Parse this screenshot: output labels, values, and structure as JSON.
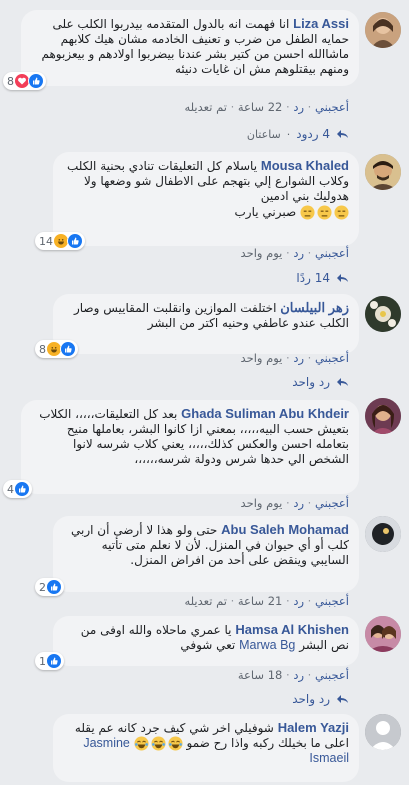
{
  "comments": [
    {
      "author": "Liza Assi",
      "text": "انا فهمت انه بالدول المتقدمه بيدربوا الكلب على حمايه الطفل من ضرب و تعنيف الخادمه مشان هيك كلابهم ماشاالله احسن من كتير بشر عندنا بيضربوا اولادهم و بيعزبوهم ومنهم بيقتلوهم مش ان غايات دنيئه",
      "reaction_count": "8",
      "reactions": [
        "like-icon",
        "love-icon"
      ],
      "like": "أعجبني",
      "reply": "رد",
      "time": "22 ساعة",
      "edited": "تم تعديله",
      "replies_label": "4 ردود",
      "replies_time": "ساعتان"
    },
    {
      "author": "Mousa Khaled",
      "text": "ياسلام كل التعليقات تنادي بحنية الكلب وكلاب الشوارع إلي بتهجم على الاطفال شو وضعها ولا هدوليك بني ادمين",
      "text2": "صبرني يارب",
      "reaction_count": "14",
      "reactions": [
        "like-icon",
        "haha-icon"
      ],
      "like": "أعجبني",
      "reply": "رد",
      "time": "يوم واحد",
      "replies_label": "14 ردًا"
    },
    {
      "author": "زهر البيلسان",
      "text": "اختلفت الموازين وانقلبت المقاييس وصار الكلب عندو عاطفي وحنيه اكتر من البشر",
      "reaction_count": "8",
      "reactions": [
        "like-icon",
        "haha-icon"
      ],
      "like": "أعجبني",
      "reply": "رد",
      "time": "يوم واحد",
      "replies_label": "رد واحد"
    },
    {
      "author": "Ghada Suliman Abu Khdeir",
      "text": "بعد كل التعليقات،،،،، الكلاب بتعيش حسب البيه،،،،، بمعني ازا كانوا البشر، بعاملها منيح بتعامله احسن والعكس كذلك،،،،، يعني كلاب شرسه لانوا الشخص الي حدها شرس ودولة شرسه،،،،،،",
      "reaction_count": "4",
      "reactions": [
        "like-icon"
      ],
      "like": "أعجبني",
      "reply": "رد",
      "time": "يوم واحد"
    },
    {
      "author": "Abu Saleh Mohamad",
      "text": "حتى ولو هذا لا أرضى أن اربي كلب أو أي حيوان في المنزل. لأن لا نعلم متى تأتيه السايبي وينقض على أحد من افراض المنزل.",
      "reaction_count": "2",
      "reactions": [
        "like-icon"
      ],
      "like": "أعجبني",
      "reply": "رد",
      "time": "21 ساعة",
      "edited": "تم تعديله"
    },
    {
      "author": "Hamsa Al Khishen",
      "text": "يا عمري ماحلاه والله اوفى من نص البشر",
      "mention": "Marwa Bg",
      "text2": "تعي شوفي",
      "reaction_count": "1",
      "reactions": [
        "like-icon"
      ],
      "like": "أعجبني",
      "reply": "رد",
      "time": "18 ساعة",
      "replies_label": "رد واحد"
    },
    {
      "author": "Halem Yazji",
      "text": "شوفيلي اخر شي كيف جرد كانه عم يقله اعلى ما بخيلك ركبه واذا رح ضمو",
      "mention": "Jasmine Ismaeil"
    }
  ],
  "colors": {
    "link": "#385898",
    "bubble": "#f2f3f5",
    "background": "#e9ebee",
    "like_blue": "#1877f2",
    "love_red": "#f33e58",
    "haha_yellow": "#f7b125"
  }
}
